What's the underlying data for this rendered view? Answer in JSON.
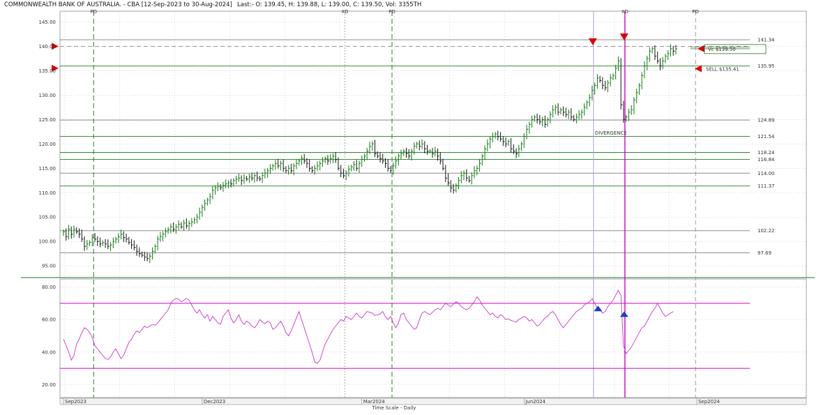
{
  "header": {
    "title": "COMMONWEALTH BANK OF AUSTRALIA. - CBA [12-Sep-2023 to 30-Aug-2024]",
    "quote": "Last:- O: 139.45, H: 139.88, L: 139.00, C: 139.50, Vol: 3355TH"
  },
  "colors": {
    "candle_up": "#0a7a0a",
    "candle_down": "#111111",
    "level_line": "#1f7a1f",
    "rsi_line": "#cc33cc",
    "rsi_band": "#cc00cc",
    "marker_red": "#dd0000",
    "marker_blue": "#1a3cc8",
    "grid": "#b8b8b8"
  },
  "chart_data": [
    {
      "type": "candlestick",
      "panel": "price",
      "y_ticks": [
        "145.00",
        "140.00",
        "135.00",
        "130.00",
        "125.00",
        "120.00",
        "115.00",
        "110.00",
        "105.00",
        "100.00",
        "95.00"
      ],
      "ylim": [
        92.6,
        147.2
      ],
      "grid": true,
      "x_labels": [
        "Sep2023",
        "Dec2023",
        "Mar2024",
        "Jun2024",
        "Sep2024"
      ],
      "xlabel": "Time Scale - Daily",
      "event_labels": [
        {
          "text": "PD",
          "index": 11
        },
        {
          "text": "XD",
          "index": 107
        },
        {
          "text": "PD",
          "index": 125
        },
        {
          "text": "XD",
          "index": 214
        },
        {
          "text": "PD",
          "index": 241
        }
      ],
      "levels": [
        {
          "value": 141.34,
          "label": "141.34"
        },
        {
          "value": 135.95,
          "label": "135.95"
        },
        {
          "value": 124.89,
          "label": "124.89"
        },
        {
          "value": 121.54,
          "label": "121.54"
        },
        {
          "value": 118.24,
          "label": "118.24"
        },
        {
          "value": 116.84,
          "label": "116.84"
        },
        {
          "value": 114.0,
          "label": "114.00"
        },
        {
          "value": 111.37,
          "label": "111.37"
        },
        {
          "value": 102.22,
          "label": "102.22"
        },
        {
          "value": 97.69,
          "label": "97.69"
        }
      ],
      "annotations": [
        {
          "text": "DIVERGENCE",
          "index": 202,
          "y": 121.9
        },
        {
          "text": "SELL $135.41",
          "value": 135.41
        },
        {
          "text": "Vc $139.50",
          "value": 139.5
        }
      ],
      "trend_levels": [
        {
          "value": 139.85,
          "label": "139.85"
        },
        {
          "value": 139.5,
          "label": "139.50"
        }
      ],
      "sell_signals": [
        {
          "index": 202,
          "y": 140.2
        },
        {
          "index": 214,
          "y": 141.2
        }
      ],
      "arrow_levels": [
        140.0,
        135.5
      ],
      "closes": [
        102.0,
        101.0,
        102.5,
        101.5,
        102.5,
        102.0,
        101.5,
        100.5,
        99.0,
        99.5,
        99.8,
        100.8,
        100.5,
        100.0,
        99.5,
        99.8,
        99.5,
        99.0,
        99.3,
        100.0,
        100.5,
        101.0,
        101.5,
        100.8,
        100.5,
        99.8,
        99.3,
        98.8,
        98.0,
        97.5,
        97.2,
        96.8,
        96.5,
        97.0,
        98.0,
        99.0,
        100.5,
        101.0,
        101.5,
        102.0,
        102.5,
        103.0,
        102.5,
        103.0,
        103.5,
        103.0,
        103.8,
        103.2,
        103.7,
        104.0,
        104.5,
        105.0,
        106.0,
        107.0,
        107.8,
        108.5,
        109.2,
        110.5,
        111.0,
        111.3,
        111.0,
        111.5,
        111.8,
        112.0,
        111.8,
        112.5,
        112.8,
        113.0,
        112.5,
        113.0,
        112.8,
        113.2,
        113.0,
        113.5,
        113.0,
        112.8,
        113.5,
        114.0,
        114.5,
        115.0,
        115.5,
        116.0,
        115.5,
        116.0,
        115.0,
        114.5,
        115.0,
        114.5,
        115.5,
        116.0,
        116.5,
        117.0,
        116.5,
        116.0,
        115.0,
        114.5,
        115.0,
        115.5,
        116.0,
        116.5,
        117.0,
        116.5,
        117.0,
        117.5,
        116.8,
        115.0,
        114.0,
        113.5,
        114.0,
        114.8,
        115.3,
        115.8,
        115.0,
        116.0,
        116.8,
        117.5,
        118.5,
        119.5,
        120.0,
        118.0,
        117.5,
        117.0,
        116.5,
        116.0,
        115.0,
        114.5,
        115.5,
        116.5,
        117.5,
        118.0,
        118.5,
        118.0,
        117.5,
        118.5,
        119.5,
        120.0,
        119.5,
        120.0,
        119.0,
        118.5,
        118.5,
        118.0,
        118.5,
        117.5,
        116.5,
        115.0,
        113.0,
        112.0,
        111.0,
        110.5,
        111.5,
        112.5,
        113.5,
        114.0,
        113.0,
        112.5,
        113.5,
        114.5,
        115.0,
        116.0,
        117.5,
        119.0,
        120.0,
        121.0,
        121.5,
        122.0,
        121.5,
        121.0,
        120.5,
        120.0,
        120.5,
        119.0,
        118.5,
        118.0,
        119.0,
        120.0,
        121.5,
        123.0,
        124.0,
        125.0,
        125.5,
        125.0,
        124.5,
        125.0,
        124.0,
        125.0,
        126.0,
        127.0,
        127.5,
        126.5,
        127.0,
        126.5,
        126.0,
        126.5,
        125.5,
        125.0,
        125.5,
        126.0,
        126.5,
        127.5,
        128.5,
        129.5,
        131.0,
        132.0,
        133.5,
        133.0,
        132.0,
        131.5,
        132.5,
        133.5,
        134.0,
        135.5,
        137.0,
        128.0,
        125.0,
        125.5,
        126.5,
        127.0,
        129.0,
        130.5,
        132.0,
        134.0,
        136.0,
        137.5,
        139.0,
        139.5,
        138.0,
        137.0,
        136.0,
        137.0,
        138.0,
        138.5,
        139.5,
        139.0,
        139.5
      ]
    },
    {
      "type": "line",
      "panel": "rsi",
      "series": [
        {
          "values": [
            48.0,
            44.0,
            40.0,
            35.0,
            38.0,
            45.0,
            48.0,
            52.0,
            55.0,
            54.0,
            52.0,
            49.0,
            44.0,
            42.0,
            40.0,
            38.0,
            36.0,
            35.5,
            37.0,
            40.0,
            42.0,
            39.0,
            36.0,
            38.0,
            42.0,
            46.0,
            48.0,
            51.0,
            53.0,
            52.0,
            54.0,
            56.0,
            55.0,
            56.0,
            57.0,
            56.5,
            58.0,
            60.0,
            62.0,
            64.0,
            66.0,
            70.0,
            72.0,
            73.0,
            72.5,
            71.0,
            72.0,
            73.0,
            72.0,
            69.0,
            66.0,
            64.0,
            66.0,
            63.0,
            61.0,
            63.0,
            59.0,
            62.0,
            60.0,
            58.0,
            57.0,
            62.0,
            64.0,
            66.0,
            61.0,
            58.0,
            60.0,
            63.0,
            59.0,
            57.0,
            59.0,
            58.0,
            56.0,
            55.0,
            57.0,
            60.0,
            58.5,
            57.5,
            59.0,
            58.0,
            54.0,
            55.0,
            57.0,
            59.0,
            56.0,
            52.0,
            50.0,
            53.0,
            57.0,
            61.0,
            65.0,
            60.0,
            55.0,
            50.0,
            45.0,
            40.0,
            34.0,
            33.0,
            35.0,
            40.0,
            45.0,
            48.0,
            51.0,
            54.0,
            56.0,
            58.0,
            60.0,
            59.0,
            62.0,
            61.0,
            60.0,
            62.0,
            64.0,
            62.0,
            61.0,
            63.0,
            65.0,
            64.5,
            64.0,
            62.5,
            63.0,
            63.5,
            65.0,
            62.0,
            60.0,
            62.0,
            58.0,
            55.0,
            58.0,
            63.0,
            64.0,
            60.0,
            58.0,
            56.0,
            54.0,
            55.0,
            60.0,
            64.0,
            65.0,
            64.0,
            63.0,
            64.5,
            66.0,
            67.0,
            66.0,
            68.0,
            70.0,
            69.0,
            68.0,
            69.5,
            71.0,
            70.0,
            68.0,
            67.0,
            66.0,
            67.0,
            69.0,
            71.0,
            74.0,
            72.0,
            69.0,
            67.0,
            65.0,
            63.0,
            64.0,
            62.0,
            61.0,
            63.0,
            62.0,
            60.0,
            60.5,
            59.5,
            59.0,
            58.5,
            60.0,
            61.0,
            62.0,
            61.0,
            59.0,
            60.0,
            58.0,
            56.0,
            57.0,
            59.0,
            61.0,
            62.0,
            64.0,
            65.0,
            63.0,
            60.0,
            57.0,
            55.0,
            57.0,
            59.0,
            61.0,
            63.0,
            65.0,
            66.0,
            67.0,
            69.0,
            70.0,
            71.0,
            73.0,
            70.0,
            67.0,
            66.0,
            64.0,
            65.0,
            68.0,
            70.0,
            72.0,
            75.0,
            78.0,
            75.0,
            44.0,
            39.0,
            41.0,
            43.0,
            46.0,
            49.0,
            52.0,
            55.0,
            56.0,
            59.0,
            62.0,
            65.0,
            67.0,
            70.0,
            67.0,
            64.0,
            62.0,
            63.0,
            64.0,
            65.0
          ]
        }
      ],
      "y_ticks": [
        "80.00",
        "60.00",
        "40.00",
        "20.00"
      ],
      "ylim": [
        12.0,
        85.0
      ],
      "bands": [
        70,
        30
      ],
      "markers": [
        {
          "index": 204,
          "value": 66.0
        },
        {
          "index": 214,
          "value": 62.5
        }
      ]
    }
  ]
}
